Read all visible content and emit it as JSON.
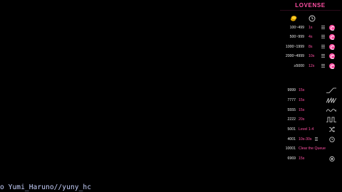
{
  "stream": {
    "watermark": "o Yumi_Haruno//yuny_hc"
  },
  "panel": {
    "brand": "LOVENSE",
    "icons": {
      "header_left": "coin-icon",
      "header_right": "clock-icon"
    },
    "accent": "#ff4fa3",
    "tip_levels": [
      {
        "range": "100~499",
        "duration": "1s"
      },
      {
        "range": "500~999",
        "duration": "4s"
      },
      {
        "range": "1000~1999",
        "duration": "8s"
      },
      {
        "range": "2000~4999",
        "duration": "10s"
      },
      {
        "range": "≥5000",
        "duration": "12s"
      }
    ],
    "special_commands": [
      {
        "amount": "9999",
        "value": "15s",
        "icon": "ramp-pattern-icon"
      },
      {
        "amount": "7777",
        "value": "15s",
        "icon": "pulse-pattern-icon"
      },
      {
        "amount": "5555",
        "value": "15s",
        "icon": "wave-pattern-icon"
      },
      {
        "amount": "2222",
        "value": "20s",
        "icon": "square-pattern-icon"
      },
      {
        "amount": "5001",
        "value": "Level 1-4",
        "icon": "shuffle-icon"
      },
      {
        "amount": "4001",
        "value": "10s-30s",
        "icon": "timer-icon"
      },
      {
        "amount": "10001",
        "value": "Clear the Queue",
        "icon": ""
      },
      {
        "amount": "6969",
        "value": "15s",
        "icon": "circle-stop-icon"
      }
    ]
  }
}
